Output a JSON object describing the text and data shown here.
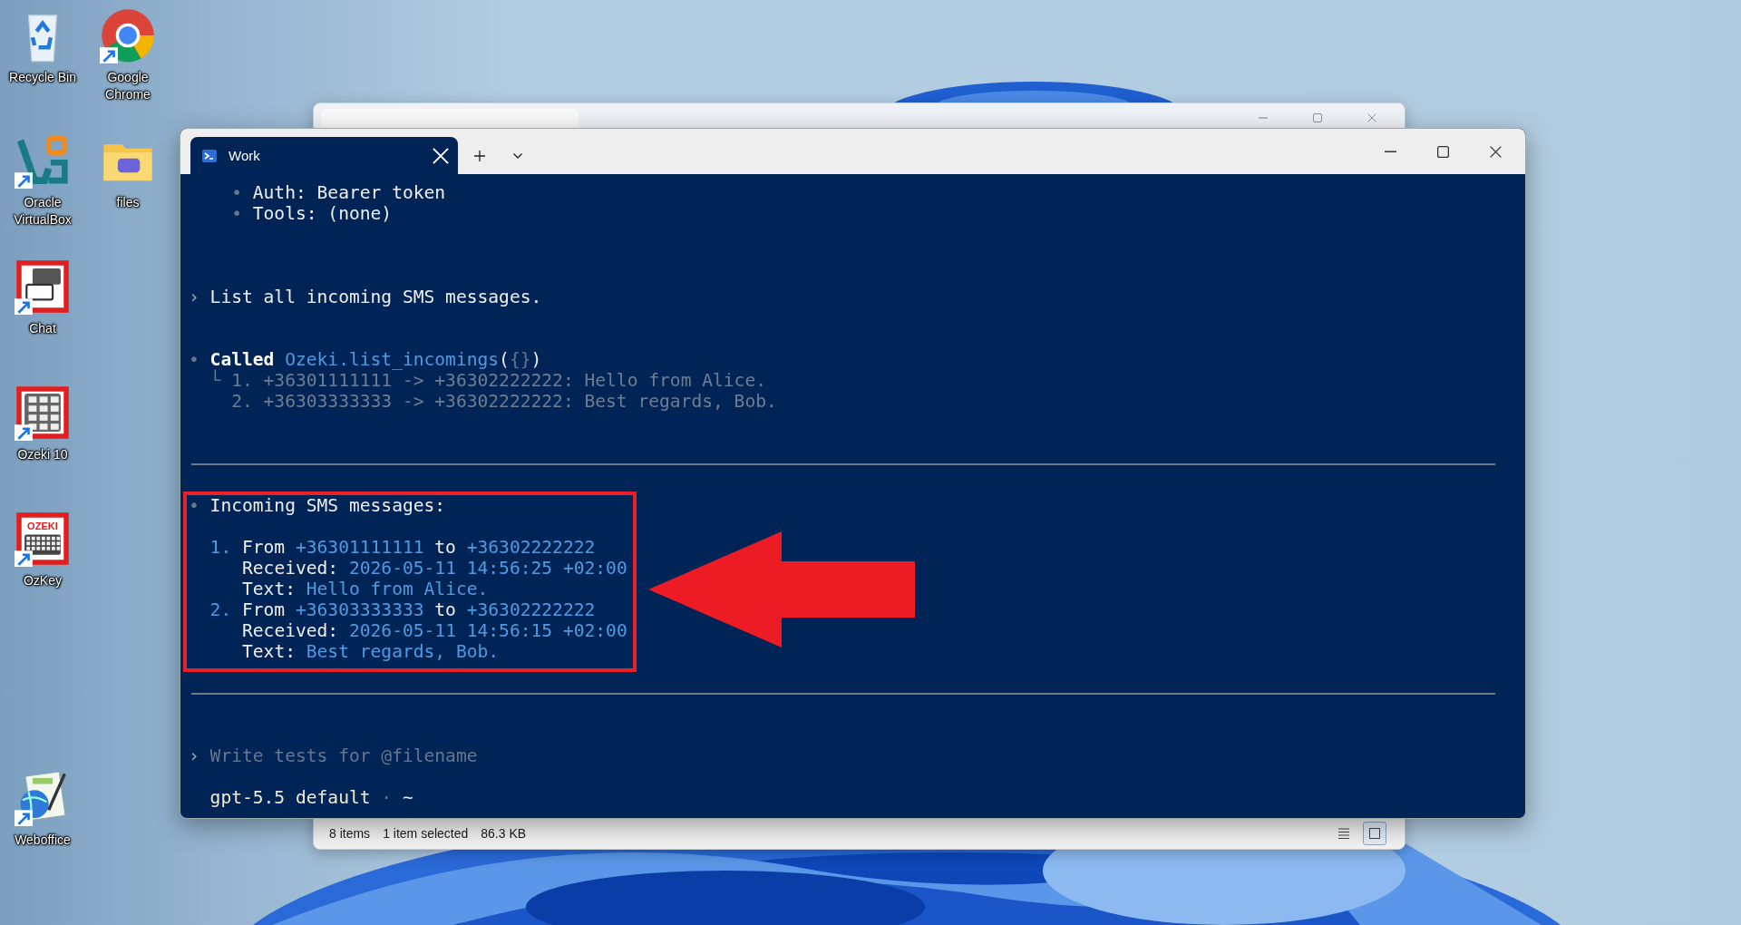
{
  "desktop_icons": [
    {
      "label": "Recycle Bin",
      "kind": "recycle",
      "shortcut": false
    },
    {
      "label": "Google Chrome",
      "kind": "chrome",
      "shortcut": true
    },
    {
      "label": "Oracle VirtualBox",
      "kind": "virtualbox",
      "shortcut": true
    },
    {
      "label": "files",
      "kind": "folder",
      "shortcut": false
    },
    {
      "label": "Chat",
      "kind": "chat",
      "shortcut": true
    },
    {
      "label": "Ozeki 10",
      "kind": "keypad",
      "shortcut": true
    },
    {
      "label": "OzKey",
      "kind": "ozkey",
      "shortcut": true,
      "badge_text": "OZEKI"
    },
    {
      "label": "Weboffice",
      "kind": "weboffice",
      "shortcut": true
    }
  ],
  "explorer_window": {
    "status_bar": {
      "item_count": "8 items",
      "selection": "1 item selected",
      "size": "86.3 KB"
    },
    "views": [
      {
        "kind": "details",
        "selected": false
      },
      {
        "kind": "tiles",
        "selected": true
      }
    ]
  },
  "terminal": {
    "tabs": [
      {
        "title": "Work",
        "selected": true
      }
    ],
    "blocks": [
      {
        "kind": "plain",
        "lines": [
          {
            "kind": "bullet",
            "marker": "•",
            "segments": [
              {
                "kind": "plain",
                "text": "Auth: Bearer token"
              }
            ]
          },
          {
            "kind": "bullet",
            "marker": "•",
            "segments": [
              {
                "kind": "plain",
                "text": "Tools: (none)"
              }
            ]
          },
          {
            "kind": "blank"
          },
          {
            "kind": "blank"
          },
          {
            "kind": "blank"
          },
          {
            "kind": "prompt",
            "marker": "›",
            "segments": [
              {
                "kind": "plain",
                "text": "List all incoming SMS messages."
              }
            ]
          },
          {
            "kind": "blank"
          },
          {
            "kind": "blank"
          },
          {
            "kind": "call",
            "marker": "•",
            "segments": [
              {
                "kind": "strong",
                "text": "Called "
              },
              {
                "kind": "accent",
                "text": "Ozeki.list_incomings"
              },
              {
                "kind": "plain",
                "text": "("
              },
              {
                "kind": "faint",
                "text": "{}"
              },
              {
                "kind": "plain",
                "text": ")"
              }
            ]
          },
          {
            "kind": "result",
            "marker": "└",
            "segments": [
              {
                "kind": "dim",
                "text": "1. +36301111111 -> +36302222222: Hello from Alice."
              }
            ]
          },
          {
            "kind": "result_cont",
            "segments": [
              {
                "kind": "dim",
                "text": "2. +36303333333 -> +36302222222: Best regards, Bob."
              }
            ]
          },
          {
            "kind": "blank"
          },
          {
            "kind": "blank"
          },
          {
            "kind": "rule"
          },
          {
            "kind": "blank"
          }
        ]
      },
      {
        "kind": "highlighted",
        "lines": [
          {
            "kind": "call",
            "marker": "•",
            "segments": [
              {
                "kind": "plain",
                "text": "Incoming SMS messages:"
              }
            ]
          },
          {
            "kind": "blank"
          },
          {
            "kind": "item",
            "marker": "1.",
            "segments": [
              {
                "kind": "plain",
                "text": "From "
              },
              {
                "kind": "accent",
                "text": "+36301111111"
              },
              {
                "kind": "plain",
                "text": " to "
              },
              {
                "kind": "accent",
                "text": "+36302222222"
              }
            ]
          },
          {
            "kind": "item_cont",
            "segments": [
              {
                "kind": "plain",
                "text": "Received: "
              },
              {
                "kind": "accent",
                "text": "2026-05-11 14:56:25 +02:00"
              }
            ]
          },
          {
            "kind": "item_cont",
            "segments": [
              {
                "kind": "plain",
                "text": "Text: "
              },
              {
                "kind": "accent",
                "text": "Hello from Alice."
              }
            ]
          },
          {
            "kind": "item",
            "marker": "2.",
            "segments": [
              {
                "kind": "plain",
                "text": "From "
              },
              {
                "kind": "accent",
                "text": "+36303333333"
              },
              {
                "kind": "plain",
                "text": " to "
              },
              {
                "kind": "accent",
                "text": "+36302222222"
              }
            ]
          },
          {
            "kind": "item_cont",
            "segments": [
              {
                "kind": "plain",
                "text": "Received: "
              },
              {
                "kind": "accent",
                "text": "2026-05-11 14:56:15 +02:00"
              }
            ]
          },
          {
            "kind": "item_cont",
            "segments": [
              {
                "kind": "plain",
                "text": "Text: "
              },
              {
                "kind": "accent",
                "text": "Best regards, Bob."
              }
            ]
          }
        ]
      },
      {
        "kind": "plain",
        "lines": [
          {
            "kind": "blank"
          },
          {
            "kind": "rule"
          },
          {
            "kind": "blank"
          },
          {
            "kind": "blank"
          },
          {
            "kind": "input",
            "marker": "›",
            "placeholder": "Write tests for @filename"
          },
          {
            "kind": "blank"
          },
          {
            "kind": "status",
            "segments": [
              {
                "kind": "status",
                "text": "gpt-5.5 default"
              },
              {
                "kind": "faint",
                "text": " · "
              },
              {
                "kind": "plain",
                "text": "~"
              }
            ]
          }
        ]
      }
    ]
  }
}
